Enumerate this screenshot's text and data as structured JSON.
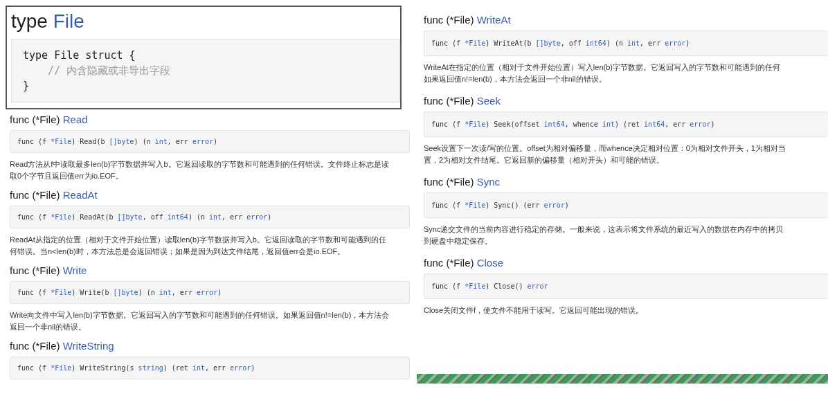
{
  "type_box": {
    "keyword": "type",
    "name": "File",
    "code": [
      {
        "text": "type File struct {",
        "kind": "code"
      },
      {
        "text": "    // 内含隐藏或非导出字段",
        "kind": "comment"
      },
      {
        "text": "}",
        "kind": "code"
      }
    ]
  },
  "columns": [
    {
      "methods": [
        {
          "prefix": "func (*File)",
          "name": "Read",
          "signature": [
            {
              "text": "func (f ",
              "kind": "plain"
            },
            {
              "text": "*File",
              "kind": "type"
            },
            {
              "text": ") Read(b ",
              "kind": "plain"
            },
            {
              "text": "[]byte",
              "kind": "type"
            },
            {
              "text": ") (n ",
              "kind": "plain"
            },
            {
              "text": "int",
              "kind": "type"
            },
            {
              "text": ", err ",
              "kind": "plain"
            },
            {
              "text": "error",
              "kind": "type"
            },
            {
              "text": ")",
              "kind": "plain"
            }
          ],
          "lines": [
            "Read方法从f中读取最多len(b)字节数据并写入b。它返回读取的字节数和可能遇到的任何错误。文件终止标志是读",
            "取0个字节且返回值err为io.EOF。"
          ]
        },
        {
          "prefix": "func (*File)",
          "name": "ReadAt",
          "signature": [
            {
              "text": "func (f ",
              "kind": "plain"
            },
            {
              "text": "*File",
              "kind": "type"
            },
            {
              "text": ") ReadAt(b ",
              "kind": "plain"
            },
            {
              "text": "[]byte",
              "kind": "type"
            },
            {
              "text": ", off ",
              "kind": "plain"
            },
            {
              "text": "int64",
              "kind": "type"
            },
            {
              "text": ") (n ",
              "kind": "plain"
            },
            {
              "text": "int",
              "kind": "type"
            },
            {
              "text": ", err ",
              "kind": "plain"
            },
            {
              "text": "error",
              "kind": "type"
            },
            {
              "text": ")",
              "kind": "plain"
            }
          ],
          "lines": [
            "ReadAt从指定的位置（相对于文件开始位置）读取len(b)字节数据并写入b。它返回读取的字节数和可能遇到的任",
            "何错误。当n<len(b)时，本方法总是会返回错误；如果是因为到达文件结尾，返回值err会是io.EOF。"
          ]
        },
        {
          "prefix": "func (*File)",
          "name": "Write",
          "signature": [
            {
              "text": "func (f ",
              "kind": "plain"
            },
            {
              "text": "*File",
              "kind": "type"
            },
            {
              "text": ") Write(b ",
              "kind": "plain"
            },
            {
              "text": "[]byte",
              "kind": "type"
            },
            {
              "text": ") (n ",
              "kind": "plain"
            },
            {
              "text": "int",
              "kind": "type"
            },
            {
              "text": ", err ",
              "kind": "plain"
            },
            {
              "text": "error",
              "kind": "type"
            },
            {
              "text": ")",
              "kind": "plain"
            }
          ],
          "lines": [
            "Write向文件中写入len(b)字节数据。它返回写入的字节数和可能遇到的任何错误。如果返回值n!=len(b)，本方法会",
            "返回一个非nil的错误。"
          ]
        },
        {
          "prefix": "func (*File)",
          "name": "WriteString",
          "signature": [
            {
              "text": "func (f ",
              "kind": "plain"
            },
            {
              "text": "*File",
              "kind": "type"
            },
            {
              "text": ") WriteString(s ",
              "kind": "plain"
            },
            {
              "text": "string",
              "kind": "type"
            },
            {
              "text": ") (ret ",
              "kind": "plain"
            },
            {
              "text": "int",
              "kind": "type"
            },
            {
              "text": ", err ",
              "kind": "plain"
            },
            {
              "text": "error",
              "kind": "type"
            },
            {
              "text": ")",
              "kind": "plain"
            }
          ]
        }
      ]
    },
    {
      "methods": [
        {
          "prefix": "func (*File)",
          "name": "WriteAt",
          "signature": [
            {
              "text": "func (f ",
              "kind": "plain"
            },
            {
              "text": "*File",
              "kind": "type"
            },
            {
              "text": ") WriteAt(b ",
              "kind": "plain"
            },
            {
              "text": "[]byte",
              "kind": "type"
            },
            {
              "text": ", off ",
              "kind": "plain"
            },
            {
              "text": "int64",
              "kind": "type"
            },
            {
              "text": ") (n ",
              "kind": "plain"
            },
            {
              "text": "int",
              "kind": "type"
            },
            {
              "text": ", err ",
              "kind": "plain"
            },
            {
              "text": "error",
              "kind": "type"
            },
            {
              "text": ")",
              "kind": "plain"
            }
          ],
          "lines": [
            "WriteAt在指定的位置（相对于文件开始位置）写入len(b)字节数据。它返回写入的字节数和可能遇到的任何",
            "如果返回值n!=len(b)，本方法会返回一个非nil的错误。"
          ]
        },
        {
          "prefix": "func (*File)",
          "name": "Seek",
          "signature": [
            {
              "text": "func (f ",
              "kind": "plain"
            },
            {
              "text": "*File",
              "kind": "type"
            },
            {
              "text": ") Seek(offset ",
              "kind": "plain"
            },
            {
              "text": "int64",
              "kind": "type"
            },
            {
              "text": ", whence ",
              "kind": "plain"
            },
            {
              "text": "int",
              "kind": "type"
            },
            {
              "text": ") (ret ",
              "kind": "plain"
            },
            {
              "text": "int64",
              "kind": "type"
            },
            {
              "text": ", err ",
              "kind": "plain"
            },
            {
              "text": "error",
              "kind": "type"
            },
            {
              "text": ")",
              "kind": "plain"
            }
          ],
          "lines": [
            "Seek设置下一次读/写的位置。offset为相对偏移量，而whence决定相对位置：0为相对文件开头，1为相对当",
            "置，2为相对文件结尾。它返回新的偏移量（相对开头）和可能的错误。"
          ]
        },
        {
          "prefix": "func (*File)",
          "name": "Sync",
          "signature": [
            {
              "text": "func (f ",
              "kind": "plain"
            },
            {
              "text": "*File",
              "kind": "type"
            },
            {
              "text": ") Sync() (err ",
              "kind": "plain"
            },
            {
              "text": "error",
              "kind": "type"
            },
            {
              "text": ")",
              "kind": "plain"
            }
          ],
          "lines": [
            "Sync递交文件的当前内容进行稳定的存储。一般来说，这表示将文件系统的最近写入的数据在内存中的拷贝",
            "到硬盘中稳定保存。"
          ]
        },
        {
          "prefix": "func (*File)",
          "name": "Close",
          "signature": [
            {
              "text": "func (f ",
              "kind": "plain"
            },
            {
              "text": "*File",
              "kind": "type"
            },
            {
              "text": ") Close() ",
              "kind": "plain"
            },
            {
              "text": "error",
              "kind": "type"
            }
          ],
          "lines": [
            "Close关闭文件f，使文件不能用于读写。它返回可能出现的错误。"
          ]
        }
      ]
    }
  ]
}
